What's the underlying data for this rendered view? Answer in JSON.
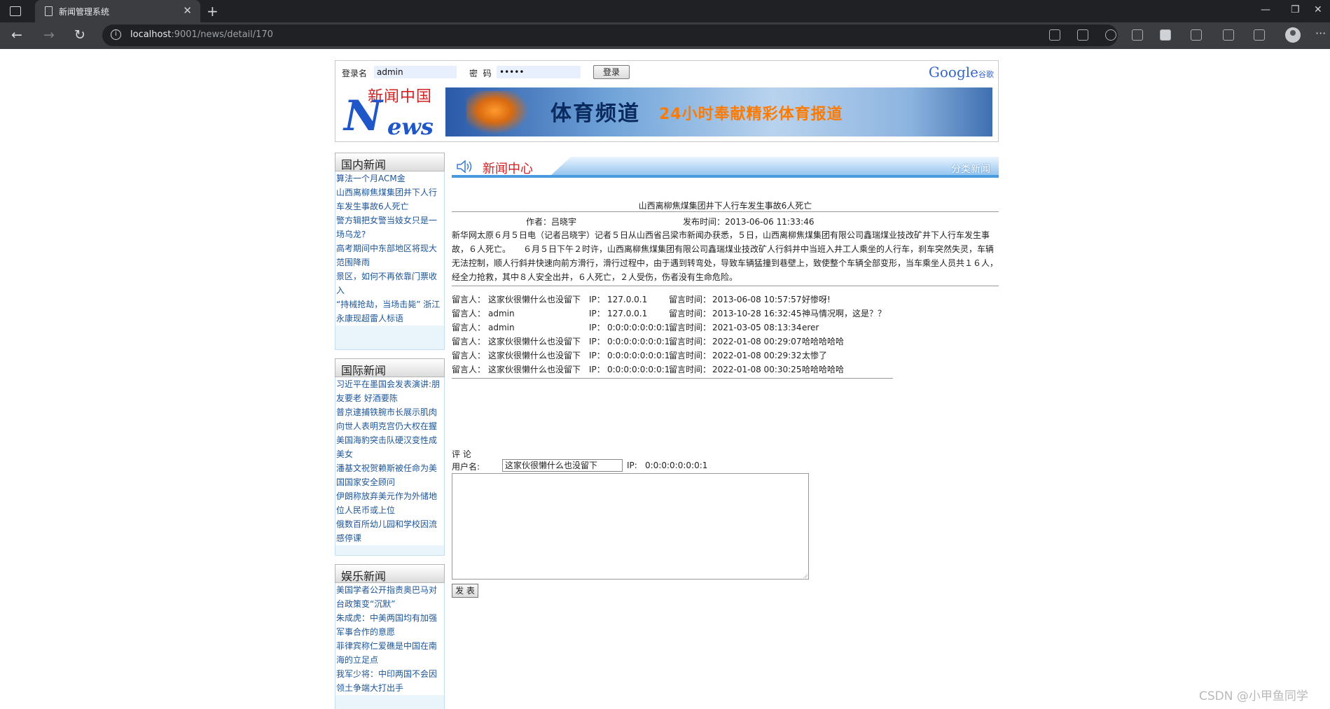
{
  "browser": {
    "tab_title": "新闻管理系统",
    "url_host": "localhost",
    "url_rest": ":9001/news/detail/170"
  },
  "login": {
    "username_label": "登录名",
    "username_value": "admin",
    "password_label": "密  码",
    "password_value": "•••••",
    "login_button": "登录"
  },
  "google": {
    "brand": "Google",
    "sub": "谷歌"
  },
  "logo": {
    "cn": "新闻中国",
    "n": "N",
    "ews": "ews"
  },
  "banner": {
    "title": "体育频道",
    "slogan": "24小时奉献精彩体育报道"
  },
  "sidebar": [
    {
      "heading": "国内新闻",
      "items": [
        "算法一个月ACM金",
        "山西离柳焦煤集团井下人行车发生事故6人死亡",
        "警方辑把女警当妓女只是一场乌龙?",
        "高考期间中东部地区将现大范围降雨",
        "景区，如何不再依靠门票收入",
        "“持械抢劫，当场击毙” 浙江永康现超雷人标语"
      ]
    },
    {
      "heading": "国际新闻",
      "items": [
        "习近平在墨国会发表演讲:朋友要老 好酒要陈",
        "普京逮捕铁腕市长展示肌肉向世人表明克宫仍大权在握",
        "美国海豹突击队硬汉变性成美女",
        "潘基文祝贺赖斯被任命为美国国家安全顾问",
        "伊朗称放弃美元作为外储地位人民币或上位",
        "俄数百所幼儿园和学校因流感停课"
      ]
    },
    {
      "heading": "娱乐新闻",
      "items": [
        "美国学者公开指责奥巴马对台政策变“沉默”",
        "朱成虎：中美两国均有加强军事合作的意愿",
        "菲律宾称仁爱礁是中国在南海的立足点",
        "我军少将：中印两国不会因领土争端大打出手"
      ]
    }
  ],
  "main": {
    "section_title": "新闻中心",
    "category_label": "分类新闻",
    "article": {
      "title": "山西离柳焦煤集团井下人行车发生事故6人死亡",
      "author_label": "作者：",
      "author": "吕晓宇",
      "date_label": "发布时间：",
      "date": "2013-06-06 11:33:46",
      "body": "新华网太原６月５日电（记者吕晓宇）记者５日从山西省吕梁市新闻办获悉，５日，山西离柳焦煤集团有限公司鑫瑞煤业技改矿井下人行车发生事故，６人死亡。　　６月５日下午２时许，山西离柳焦煤集团有限公司鑫瑞煤业技改矿人行斜井中当班入井工人乘坐的人行车，刹车突然失灵，车辆无法控制，顺人行斜井快速向前方滑行，滑行过程中，由于遇到转弯处，导致车辆猛撞到巷壁上，致使整个车辆全部变形，当车乘坐人员共１６人，经全力抢救，其中８人安全出井，６人死亡，２人受伤，伤者没有生命危险。"
    },
    "comments": {
      "user_label": "留言人：",
      "ip_label": "IP：",
      "time_label": "留言时间：",
      "rows": [
        {
          "user": "这家伙很懒什么也没留下",
          "ip": "127.0.0.1",
          "time": "2013-06-08 10:57:57",
          "text": "好惨呀!"
        },
        {
          "user": "admin",
          "ip": "127.0.0.1",
          "time": "2013-10-28 16:32:45",
          "text": "神马情况啊，这是？？"
        },
        {
          "user": "admin",
          "ip": "0:0:0:0:0:0:0:1",
          "time": "2021-03-05 08:13:34",
          "text": "erer"
        },
        {
          "user": "这家伙很懒什么也没留下",
          "ip": "0:0:0:0:0:0:0:1",
          "time": "2022-01-08 00:29:07",
          "text": "哈哈哈哈哈"
        },
        {
          "user": "这家伙很懒什么也没留下",
          "ip": "0:0:0:0:0:0:0:1",
          "time": "2022-01-08 00:29:32",
          "text": "太惨了"
        },
        {
          "user": "这家伙很懒什么也没留下",
          "ip": "0:0:0:0:0:0:0:1",
          "time": "2022-01-08 00:30:25",
          "text": "哈哈哈哈哈"
        }
      ]
    },
    "comment_form": {
      "heading": "评 论",
      "user_label": "用户名:",
      "user_value": "这家伙很懒什么也没留下",
      "ip_label": "IP:",
      "ip_value": "0:0:0:0:0:0:0:1",
      "submit": "发 表"
    }
  },
  "watermark": "CSDN @小甲鱼同学"
}
